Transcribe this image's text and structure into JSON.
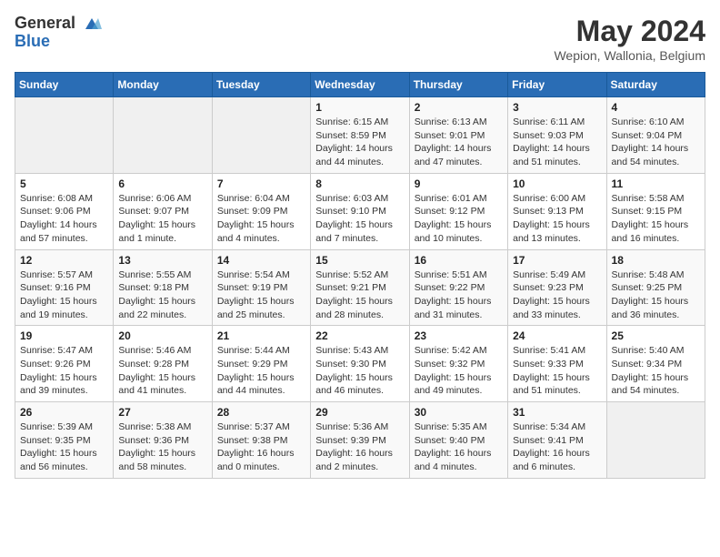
{
  "header": {
    "logo_general": "General",
    "logo_blue": "Blue",
    "month_year": "May 2024",
    "location": "Wepion, Wallonia, Belgium"
  },
  "weekdays": [
    "Sunday",
    "Monday",
    "Tuesday",
    "Wednesday",
    "Thursday",
    "Friday",
    "Saturday"
  ],
  "weeks": [
    [
      {
        "day": "",
        "info": ""
      },
      {
        "day": "",
        "info": ""
      },
      {
        "day": "",
        "info": ""
      },
      {
        "day": "1",
        "info": "Sunrise: 6:15 AM\nSunset: 8:59 PM\nDaylight: 14 hours\nand 44 minutes."
      },
      {
        "day": "2",
        "info": "Sunrise: 6:13 AM\nSunset: 9:01 PM\nDaylight: 14 hours\nand 47 minutes."
      },
      {
        "day": "3",
        "info": "Sunrise: 6:11 AM\nSunset: 9:03 PM\nDaylight: 14 hours\nand 51 minutes."
      },
      {
        "day": "4",
        "info": "Sunrise: 6:10 AM\nSunset: 9:04 PM\nDaylight: 14 hours\nand 54 minutes."
      }
    ],
    [
      {
        "day": "5",
        "info": "Sunrise: 6:08 AM\nSunset: 9:06 PM\nDaylight: 14 hours\nand 57 minutes."
      },
      {
        "day": "6",
        "info": "Sunrise: 6:06 AM\nSunset: 9:07 PM\nDaylight: 15 hours\nand 1 minute."
      },
      {
        "day": "7",
        "info": "Sunrise: 6:04 AM\nSunset: 9:09 PM\nDaylight: 15 hours\nand 4 minutes."
      },
      {
        "day": "8",
        "info": "Sunrise: 6:03 AM\nSunset: 9:10 PM\nDaylight: 15 hours\nand 7 minutes."
      },
      {
        "day": "9",
        "info": "Sunrise: 6:01 AM\nSunset: 9:12 PM\nDaylight: 15 hours\nand 10 minutes."
      },
      {
        "day": "10",
        "info": "Sunrise: 6:00 AM\nSunset: 9:13 PM\nDaylight: 15 hours\nand 13 minutes."
      },
      {
        "day": "11",
        "info": "Sunrise: 5:58 AM\nSunset: 9:15 PM\nDaylight: 15 hours\nand 16 minutes."
      }
    ],
    [
      {
        "day": "12",
        "info": "Sunrise: 5:57 AM\nSunset: 9:16 PM\nDaylight: 15 hours\nand 19 minutes."
      },
      {
        "day": "13",
        "info": "Sunrise: 5:55 AM\nSunset: 9:18 PM\nDaylight: 15 hours\nand 22 minutes."
      },
      {
        "day": "14",
        "info": "Sunrise: 5:54 AM\nSunset: 9:19 PM\nDaylight: 15 hours\nand 25 minutes."
      },
      {
        "day": "15",
        "info": "Sunrise: 5:52 AM\nSunset: 9:21 PM\nDaylight: 15 hours\nand 28 minutes."
      },
      {
        "day": "16",
        "info": "Sunrise: 5:51 AM\nSunset: 9:22 PM\nDaylight: 15 hours\nand 31 minutes."
      },
      {
        "day": "17",
        "info": "Sunrise: 5:49 AM\nSunset: 9:23 PM\nDaylight: 15 hours\nand 33 minutes."
      },
      {
        "day": "18",
        "info": "Sunrise: 5:48 AM\nSunset: 9:25 PM\nDaylight: 15 hours\nand 36 minutes."
      }
    ],
    [
      {
        "day": "19",
        "info": "Sunrise: 5:47 AM\nSunset: 9:26 PM\nDaylight: 15 hours\nand 39 minutes."
      },
      {
        "day": "20",
        "info": "Sunrise: 5:46 AM\nSunset: 9:28 PM\nDaylight: 15 hours\nand 41 minutes."
      },
      {
        "day": "21",
        "info": "Sunrise: 5:44 AM\nSunset: 9:29 PM\nDaylight: 15 hours\nand 44 minutes."
      },
      {
        "day": "22",
        "info": "Sunrise: 5:43 AM\nSunset: 9:30 PM\nDaylight: 15 hours\nand 46 minutes."
      },
      {
        "day": "23",
        "info": "Sunrise: 5:42 AM\nSunset: 9:32 PM\nDaylight: 15 hours\nand 49 minutes."
      },
      {
        "day": "24",
        "info": "Sunrise: 5:41 AM\nSunset: 9:33 PM\nDaylight: 15 hours\nand 51 minutes."
      },
      {
        "day": "25",
        "info": "Sunrise: 5:40 AM\nSunset: 9:34 PM\nDaylight: 15 hours\nand 54 minutes."
      }
    ],
    [
      {
        "day": "26",
        "info": "Sunrise: 5:39 AM\nSunset: 9:35 PM\nDaylight: 15 hours\nand 56 minutes."
      },
      {
        "day": "27",
        "info": "Sunrise: 5:38 AM\nSunset: 9:36 PM\nDaylight: 15 hours\nand 58 minutes."
      },
      {
        "day": "28",
        "info": "Sunrise: 5:37 AM\nSunset: 9:38 PM\nDaylight: 16 hours\nand 0 minutes."
      },
      {
        "day": "29",
        "info": "Sunrise: 5:36 AM\nSunset: 9:39 PM\nDaylight: 16 hours\nand 2 minutes."
      },
      {
        "day": "30",
        "info": "Sunrise: 5:35 AM\nSunset: 9:40 PM\nDaylight: 16 hours\nand 4 minutes."
      },
      {
        "day": "31",
        "info": "Sunrise: 5:34 AM\nSunset: 9:41 PM\nDaylight: 16 hours\nand 6 minutes."
      },
      {
        "day": "",
        "info": ""
      }
    ]
  ]
}
